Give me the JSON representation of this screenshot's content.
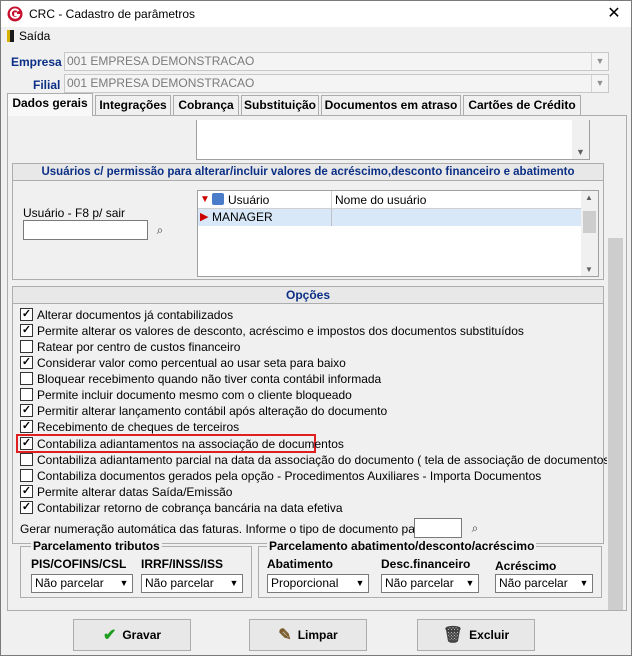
{
  "window": {
    "title": "CRC - Cadastro de parâmetros",
    "close_glyph": "✕",
    "app_icon": "g-logo-icon"
  },
  "menu": {
    "exit_label": "Saída"
  },
  "header": {
    "empresa_label": "Empresa",
    "empresa_value": "001 EMPRESA DEMONSTRACAO",
    "filial_label": "Filial",
    "filial_value": "001 EMPRESA DEMONSTRACAO"
  },
  "tabs": [
    {
      "label": "Dados gerais",
      "active": true
    },
    {
      "label": "Integrações"
    },
    {
      "label": "Cobrança"
    },
    {
      "label": "Substituição"
    },
    {
      "label": "Documentos em atraso"
    },
    {
      "label": "Cartões de Crédito"
    }
  ],
  "users_group": {
    "title": "Usuários c/ permissão para alterar/incluir valores de acréscimo,desconto financeiro e abatimento",
    "user_field_label": "Usuário - F8 p/ sair",
    "grid_headers": [
      "Usuário",
      "Nome do usuário"
    ],
    "rows": [
      {
        "user": "MANAGER",
        "name": ""
      }
    ]
  },
  "options_group": {
    "title": "Opções",
    "items": [
      {
        "label": "Alterar documentos já contabilizados",
        "checked": true
      },
      {
        "label": "Permite alterar os valores de desconto, acréscimo  e impostos dos documentos substituídos",
        "checked": true
      },
      {
        "label": "Ratear por centro de custos financeiro",
        "checked": false
      },
      {
        "label": "Considerar valor como percentual ao usar seta para baixo",
        "checked": true
      },
      {
        "label": "Bloquear recebimento quando não tiver conta contábil informada",
        "checked": false
      },
      {
        "label": "Permite incluir documento mesmo com o cliente bloqueado",
        "checked": false
      },
      {
        "label": "Permitir alterar lançamento contábil após alteração do documento",
        "checked": true
      },
      {
        "label": "Recebimento de cheques de terceiros",
        "checked": true
      },
      {
        "label": "Contabiliza adiantamentos na associação de documentos",
        "checked": true,
        "highlighted": true
      },
      {
        "label": "Contabiliza adiantamento parcial na data da associação do documento ( tela de associação de documentos )",
        "checked": false
      },
      {
        "label": "Contabiliza documentos gerados pela opção - Procedimentos Auxiliares - Importa Documentos",
        "checked": false
      },
      {
        "label": "Permite alterar datas Saída/Emissão",
        "checked": true
      },
      {
        "label": "Contabilizar retorno de cobrança bancária na data efetiva",
        "checked": true
      }
    ],
    "numbering_label": "Gerar numeração automática das faturas. Informe o tipo de documento para fatura"
  },
  "parcelamento_tributos": {
    "title": "Parcelamento tributos",
    "col1_label": "PIS/COFINS/CSL",
    "col1_value": "Não parcelar",
    "col2_label": "IRRF/INSS/ISS",
    "col2_value": "Não parcelar"
  },
  "parcelamento_abatimento": {
    "title": "Parcelamento abatimento/desconto/acréscimo",
    "abatimento_label": "Abatimento",
    "abatimento_value": "Proporcional",
    "desc_label": "Desc.financeiro",
    "desc_value": "Não parcelar",
    "acresc_label": "Acréscimo",
    "acresc_value": "Não parcelar"
  },
  "buttons": {
    "save_label": "Gravar",
    "clear_label": "Limpar",
    "delete_label": "Excluir"
  },
  "colors": {
    "accent": "#0b2f85",
    "highlight": "#e02020",
    "check_green": "#1e9e1e"
  }
}
